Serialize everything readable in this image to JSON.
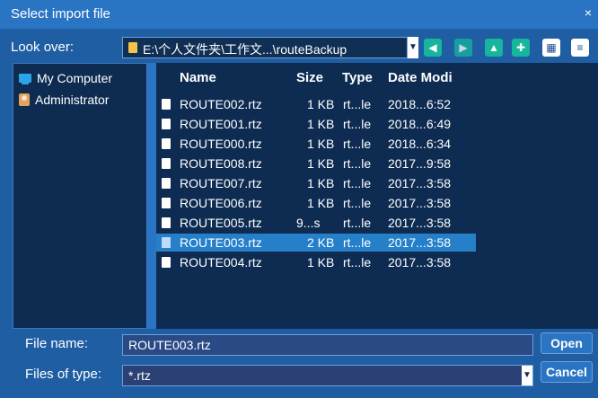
{
  "window": {
    "title": "Select import file"
  },
  "look_over": {
    "label": "Look over:",
    "path": "E:\\个人文件夹\\工作文...\\routeBackup"
  },
  "left_panel": {
    "items": [
      {
        "label": "My Computer",
        "icon": "computer-icon"
      },
      {
        "label": "Administrator",
        "icon": "user-folder-icon"
      }
    ]
  },
  "file_list": {
    "columns": [
      "Name",
      "Size",
      "Type",
      "Date Modi"
    ],
    "rows": [
      {
        "name": "ROUTE002.rtz",
        "size": "1 KB",
        "type": "rt...le",
        "date": "2018...6:52"
      },
      {
        "name": "ROUTE001.rtz",
        "size": "1 KB",
        "type": "rt...le",
        "date": "2018...6:49"
      },
      {
        "name": "ROUTE000.rtz",
        "size": "1 KB",
        "type": "rt...le",
        "date": "2018...6:34"
      },
      {
        "name": "ROUTE008.rtz",
        "size": "1 KB",
        "type": "rt...le",
        "date": "2017...9:58"
      },
      {
        "name": "ROUTE007.rtz",
        "size": "1 KB",
        "type": "rt...le",
        "date": "2017...3:58"
      },
      {
        "name": "ROUTE006.rtz",
        "size": "1 KB",
        "type": "rt...le",
        "date": "2017...3:58"
      },
      {
        "name": "ROUTE005.rtz",
        "size": "9...s",
        "type": "rt...le",
        "date": "2017...3:58"
      },
      {
        "name": "ROUTE003.rtz",
        "size": "2 KB",
        "type": "rt...le",
        "date": "2017...3:58",
        "selected": true
      },
      {
        "name": "ROUTE004.rtz",
        "size": "1 KB",
        "type": "rt...le",
        "date": "2017...3:58"
      }
    ]
  },
  "file_name": {
    "label": "File name:",
    "value": "ROUTE003.rtz"
  },
  "file_type": {
    "label": "Files of type:",
    "value": "*.rtz"
  },
  "buttons": {
    "open": "Open",
    "cancel": "Cancel"
  },
  "colors": {
    "title_bar": "#2a74c4",
    "panel_bg": "#0e2c52",
    "selected_row": "#2680c9",
    "accent_green": "#16b59c"
  }
}
